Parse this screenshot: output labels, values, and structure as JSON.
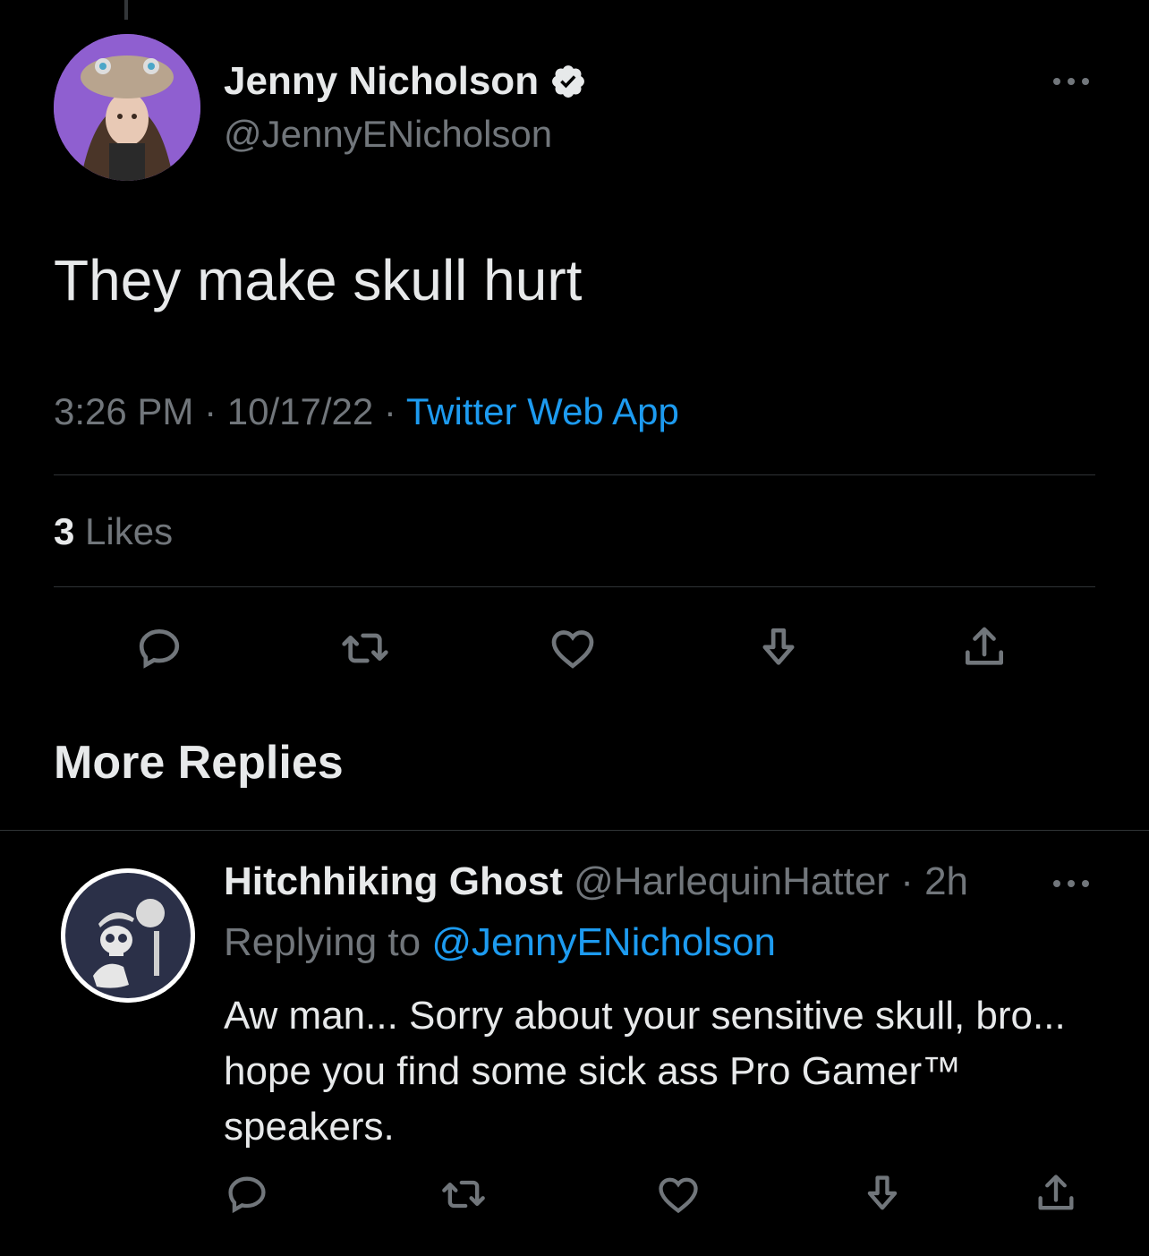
{
  "tweet": {
    "author_name": "Jenny Nicholson",
    "author_handle": "@JennyENicholson",
    "text": "They make skull hurt",
    "time": "3:26 PM",
    "date": "10/17/22",
    "source": "Twitter Web App",
    "likes_count": "3",
    "likes_label": "Likes"
  },
  "section": {
    "more_replies_label": "More Replies"
  },
  "reply": {
    "author_name": "Hitchhiking Ghost",
    "author_handle": "@HarlequinHatter",
    "age": "2h",
    "replying_prefix": "Replying to",
    "replying_to": "@JennyENicholson",
    "text": "Aw man... Sorry about your sensitive skull, bro... hope you find some sick ass Pro Gamer™ speakers."
  },
  "icons": [
    "reply-icon",
    "retweet-icon",
    "like-icon",
    "bookmark-icon",
    "share-icon",
    "more-icon",
    "verified-icon"
  ],
  "colors": {
    "background": "#000000",
    "text": "#e7e9ea",
    "secondary": "#71767b",
    "link": "#1d9bf0",
    "divider": "#2f3336"
  }
}
